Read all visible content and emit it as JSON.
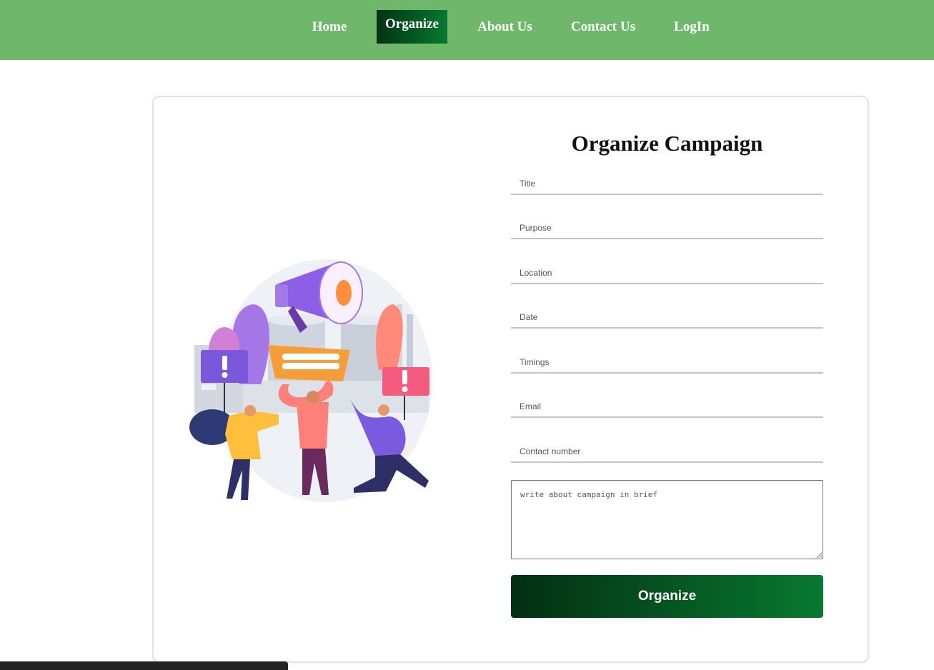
{
  "nav": {
    "items": [
      {
        "label": "Home"
      },
      {
        "label": "Organize"
      },
      {
        "label": "About Us"
      },
      {
        "label": "Contact Us"
      },
      {
        "label": "LogIn"
      }
    ],
    "active": "Organize",
    "background_color": "#6fb86b"
  },
  "form": {
    "title": "Organize Campaign",
    "fields": [
      {
        "placeholder": "Title"
      },
      {
        "placeholder": "Purpose"
      },
      {
        "placeholder": "Location"
      },
      {
        "placeholder": "Date"
      },
      {
        "placeholder": "Timings"
      },
      {
        "placeholder": "Email"
      },
      {
        "placeholder": "Contact number"
      }
    ],
    "brief_placeholder": "write about campaign in brief",
    "submit_label": "Organize",
    "button_gradient": [
      "#032f12",
      "#07792f"
    ]
  },
  "illustration": {
    "icon": "megaphone-protest-illustration"
  }
}
